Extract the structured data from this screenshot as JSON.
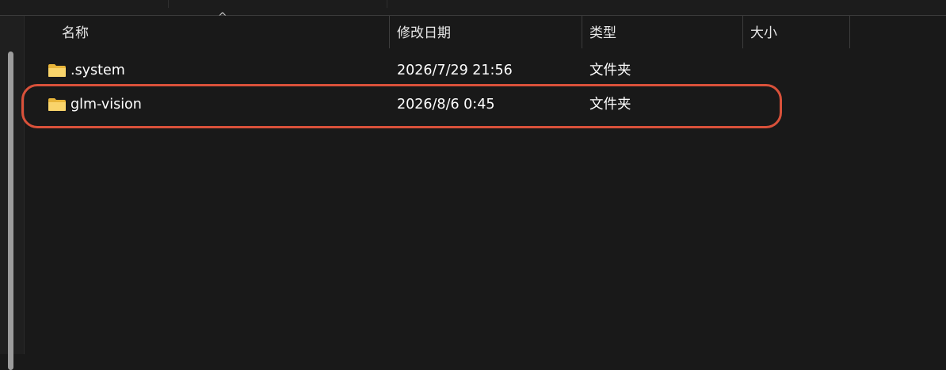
{
  "columns": {
    "name": "名称",
    "date": "修改日期",
    "type": "类型",
    "size": "大小"
  },
  "files": [
    {
      "name": ".system",
      "date": "2026/7/29 21:56",
      "type": "文件夹",
      "size": "",
      "icon": "folder-icon"
    },
    {
      "name": "glm-vision",
      "date": "2026/8/6 0:45",
      "type": "文件夹",
      "size": "",
      "icon": "folder-icon",
      "highlighted": true
    }
  ],
  "colors": {
    "background": "#191919",
    "text": "#ffffff",
    "highlight": "#d9513a",
    "folder": "#f4c542"
  }
}
